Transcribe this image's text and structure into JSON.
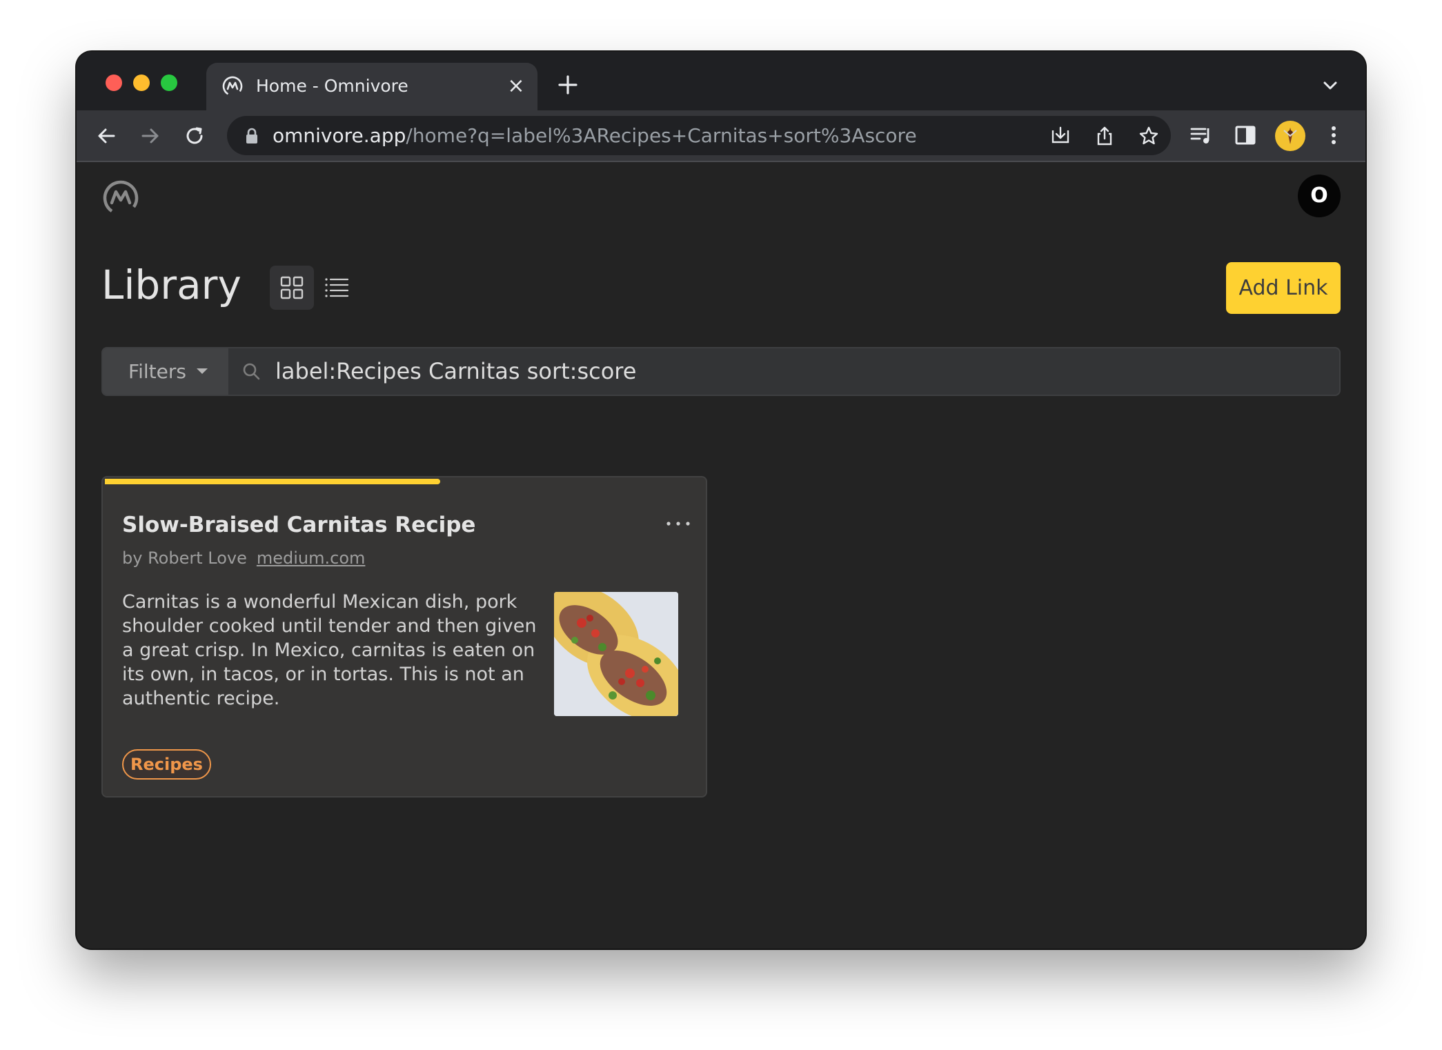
{
  "browser": {
    "tab": {
      "title": "Home - Omnivore",
      "close_icon": "×",
      "favicon": "omnivore-logo-icon"
    },
    "url_host": "omnivore.app",
    "url_path": "/home?q=label%3ARecipes+Carnitas+sort%3Ascore",
    "traffic_light_colors": [
      "#fe5f57",
      "#febc2e",
      "#28c840"
    ]
  },
  "header": {
    "avatar_initial": "O"
  },
  "library": {
    "title": "Library",
    "add_link_label": "Add Link",
    "accent_color": "#fed131",
    "filters_label": "Filters",
    "search_value": "label:Recipes Carnitas sort:score"
  },
  "card": {
    "title": "Slow-Braised Carnitas Recipe",
    "author": "by Robert Love",
    "source": "medium.com",
    "description": "Carnitas is a wonderful Mexican dish, pork shoulder cooked until tender and then given a great crisp. In Mexico, carnitas is eaten on its own, in tacos, or in tortas. This is not an authentic recipe.",
    "menu_icon": "···",
    "reading_progress_percent": 56,
    "label": "Recipes",
    "label_color": "#f0974a"
  }
}
